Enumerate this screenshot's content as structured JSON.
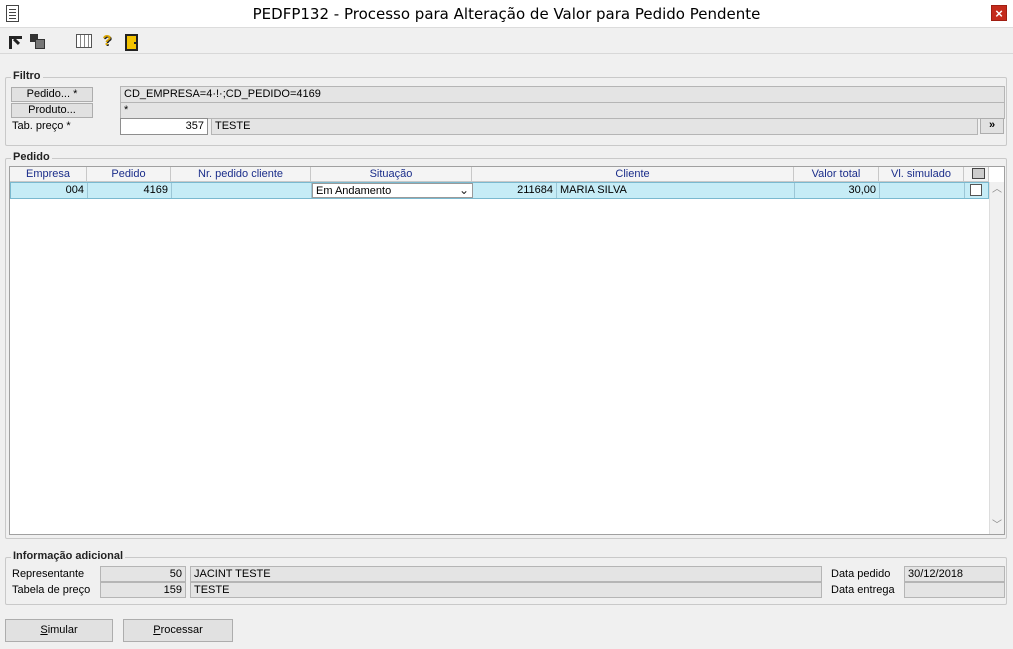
{
  "window": {
    "title": "PEDFP132 - Processo para Alteração de Valor para Pedido Pendente",
    "close_label": "×"
  },
  "toolbar": {
    "icons": [
      "first-record-icon",
      "multi-window-icon",
      "grid-view-icon",
      "help-icon",
      "exit-door-icon"
    ],
    "help_glyph": "?"
  },
  "filtro": {
    "legend": "Filtro",
    "pedido_button": "Pedido... *",
    "pedido_value": "CD_EMPRESA=4·!·;CD_PEDIDO=4169",
    "produto_button": "Produto...",
    "produto_value": "*",
    "tab_preco_label": "Tab. preço *",
    "tab_preco_code": "357",
    "tab_preco_name": "TESTE",
    "next_button": "»"
  },
  "pedido": {
    "legend": "Pedido",
    "columns": [
      "Empresa",
      "Pedido",
      "Nr. pedido cliente",
      "Situação",
      "Cliente",
      "Valor total",
      "Vl. simulado"
    ],
    "rows": [
      {
        "empresa": "004",
        "pedido": "4169",
        "nr_pedido_cliente": "",
        "situacao": "Em Andamento",
        "cliente_codigo": "211684",
        "cliente_nome": "MARIA SILVA",
        "valor_total": "30,00",
        "vl_simulado": "",
        "selecionado": false
      }
    ]
  },
  "info": {
    "legend": "Informação adicional",
    "representante_label": "Representante",
    "representante_code": "50",
    "representante_name": "JACINT TESTE",
    "tabela_label": "Tabela de preço",
    "tabela_code": "159",
    "tabela_name": "TESTE",
    "data_pedido_label": "Data pedido",
    "data_pedido_value": "30/12/2018",
    "data_entrega_label": "Data entrega",
    "data_entrega_value": ""
  },
  "actions": {
    "simular_label": "imular",
    "simular_accel": "S",
    "processar_label": "rocessar",
    "processar_accel": "P"
  }
}
